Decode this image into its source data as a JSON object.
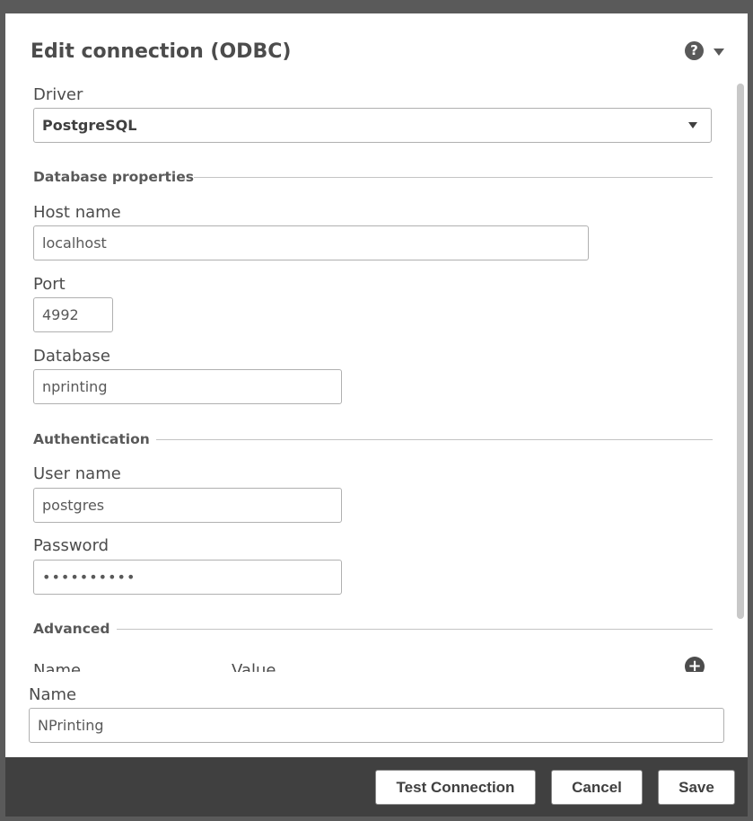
{
  "dialog": {
    "title": "Edit connection (ODBC)",
    "help_icon_glyph": "?",
    "icons": [
      "help-icon",
      "menu-caret-icon",
      "select-caret-icon",
      "add-icon"
    ]
  },
  "driver": {
    "label": "Driver",
    "value": "PostgreSQL"
  },
  "database_properties": {
    "heading": "Database properties",
    "host": {
      "label": "Host name",
      "value": "localhost"
    },
    "port": {
      "label": "Port",
      "value": "4992"
    },
    "database": {
      "label": "Database",
      "value": "nprinting"
    }
  },
  "authentication": {
    "heading": "Authentication",
    "user": {
      "label": "User name",
      "value": "postgres"
    },
    "password": {
      "label": "Password",
      "value": "••••••••••"
    }
  },
  "advanced": {
    "heading": "Advanced",
    "columns": [
      "Name",
      "Value"
    ],
    "add_glyph": "+"
  },
  "connection_name": {
    "label": "Name",
    "value": "NPrinting"
  },
  "footer": {
    "test_label": "Test Connection",
    "cancel_label": "Cancel",
    "save_label": "Save"
  },
  "colors": {
    "footer_bg": "#404040",
    "dialog_bg": "#ffffff",
    "border": "#b0b0b0"
  }
}
